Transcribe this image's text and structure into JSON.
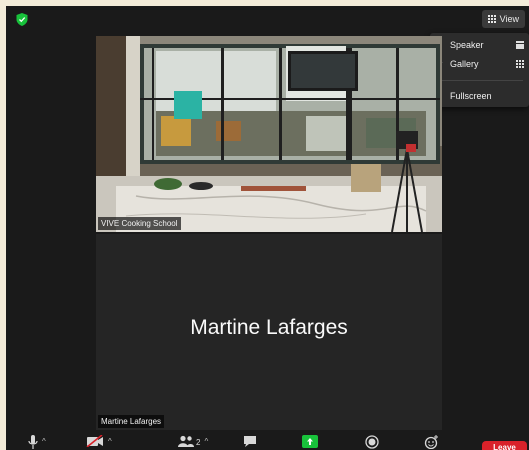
{
  "header": {
    "view_label": "View"
  },
  "view_menu": {
    "items": [
      {
        "label": "Speaker",
        "checked": false,
        "icon": "speaker-view-icon"
      },
      {
        "label": "Gallery",
        "checked": true,
        "icon": "gallery-view-icon"
      },
      {
        "label": "Fullscreen",
        "checked": false,
        "icon": ""
      }
    ],
    "check_glyph": "✓"
  },
  "participants": [
    {
      "name": "VIVE Cooking School",
      "video_on": true
    },
    {
      "name": "Martine Lafarges",
      "video_on": false,
      "display_name": "Martine Lafarges"
    }
  ],
  "toolbar": {
    "caret_glyph": "^",
    "participant_count": "2",
    "leave_label": "Leave"
  },
  "colors": {
    "accent_green": "#18c23b",
    "leave_red": "#d9222a",
    "background": "#1a1a1a"
  }
}
